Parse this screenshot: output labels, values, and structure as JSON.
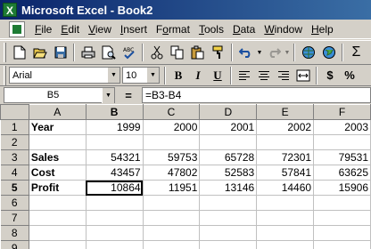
{
  "window": {
    "app_icon": "excel-x-icon",
    "title": "Microsoft Excel - Book2"
  },
  "menu": {
    "items": [
      {
        "underline": "F",
        "rest": "ile"
      },
      {
        "underline": "E",
        "rest": "dit"
      },
      {
        "underline": "V",
        "rest": "iew"
      },
      {
        "underline": "I",
        "rest": "nsert"
      },
      {
        "pre": "F",
        "underline": "o",
        "rest": "rmat"
      },
      {
        "underline": "T",
        "rest": "ools"
      },
      {
        "underline": "D",
        "rest": "ata"
      },
      {
        "underline": "W",
        "rest": "indow"
      },
      {
        "underline": "H",
        "rest": "elp"
      }
    ]
  },
  "toolbar": {
    "sum_symbol": "Σ"
  },
  "format_toolbar": {
    "font_name": "Arial",
    "font_size": "10",
    "bold": "B",
    "italic": "I",
    "underline": "U",
    "currency": "$",
    "percent": "%"
  },
  "formula_bar": {
    "name_box": "B5",
    "equals": "=",
    "formula": "=B3-B4"
  },
  "sheet": {
    "columns": [
      "A",
      "B",
      "C",
      "D",
      "E",
      "F"
    ],
    "active_column": "B",
    "active_row": "5",
    "rows": [
      {
        "num": "1",
        "cells": [
          "Year",
          "1999",
          "2000",
          "2001",
          "2002",
          "2003"
        ]
      },
      {
        "num": "2",
        "cells": [
          "",
          "",
          "",
          "",
          "",
          ""
        ]
      },
      {
        "num": "3",
        "cells": [
          "Sales",
          "54321",
          "59753",
          "65728",
          "72301",
          "79531"
        ]
      },
      {
        "num": "4",
        "cells": [
          "Cost",
          "43457",
          "47802",
          "52583",
          "57841",
          "63625"
        ]
      },
      {
        "num": "5",
        "cells": [
          "Profit",
          "10864",
          "11951",
          "13146",
          "14460",
          "15906"
        ]
      },
      {
        "num": "6",
        "cells": [
          "",
          "",
          "",
          "",
          "",
          ""
        ]
      },
      {
        "num": "7",
        "cells": [
          "",
          "",
          "",
          "",
          "",
          ""
        ]
      },
      {
        "num": "8",
        "cells": [
          "",
          "",
          "",
          "",
          "",
          ""
        ]
      },
      {
        "num": "9",
        "cells": [
          "",
          "",
          "",
          "",
          "",
          ""
        ]
      }
    ]
  }
}
